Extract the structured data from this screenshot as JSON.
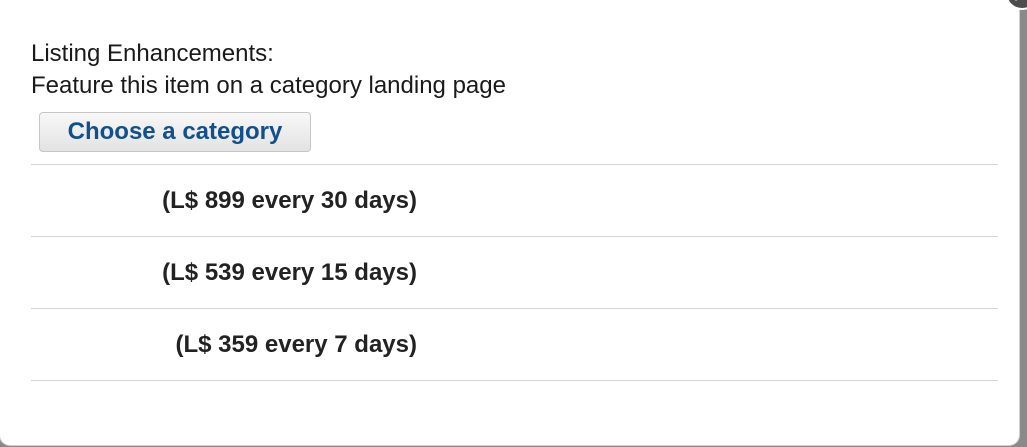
{
  "dialog": {
    "heading": "Listing Enhancements:",
    "subheading": "Feature this item on a category landing page",
    "choose_button_label": "Choose a category",
    "close_icon": "close-icon",
    "price_options": [
      {
        "label": "(L$ 899 every 30 days)"
      },
      {
        "label": "(L$ 539 every 15 days)"
      },
      {
        "label": "(L$ 359 every 7 days)"
      }
    ]
  },
  "colors": {
    "button_text": "#124f8e",
    "text": "#1a1a1a",
    "divider": "#d4d4d4"
  }
}
